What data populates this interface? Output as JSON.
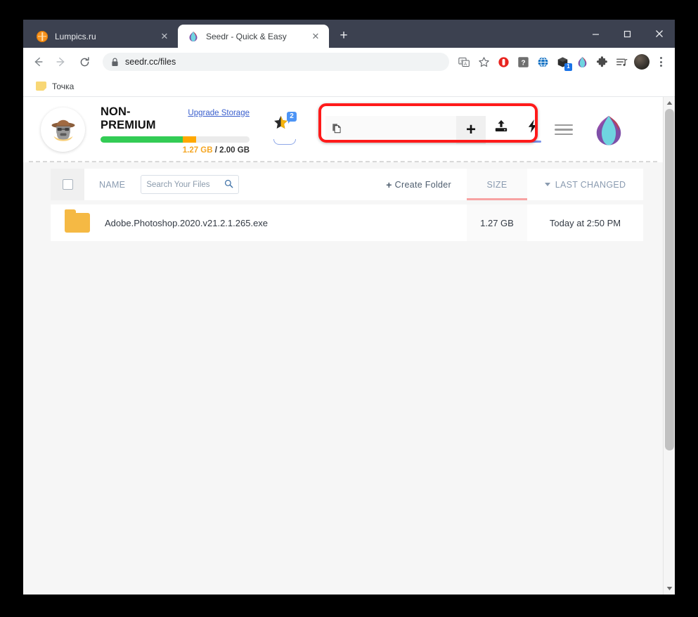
{
  "browser": {
    "tabs": [
      {
        "title": "Lumpics.ru",
        "favicon": "orange-circle-icon",
        "active": false,
        "close_label": "✕"
      },
      {
        "title": "Seedr - Quick & Easy",
        "favicon": "seedr-lotus-icon",
        "active": true,
        "close_label": "✕"
      }
    ],
    "new_tab_label": "+",
    "window_controls": {
      "minimize": "minimize-icon",
      "maximize": "maximize-icon",
      "close": "close-icon"
    },
    "nav": {
      "back": "back-arrow-icon",
      "forward": "forward-arrow-icon",
      "reload": "reload-icon"
    },
    "omnibox": {
      "lock": "lock-icon",
      "url": "seedr.cc/files"
    },
    "toolbar_icons": [
      {
        "name": "translate-icon"
      },
      {
        "name": "bookmark-star-icon"
      },
      {
        "name": "adblock-icon"
      },
      {
        "name": "question-extension-icon"
      },
      {
        "name": "globe-extension-icon"
      },
      {
        "name": "box-extension-icon",
        "badge": "1"
      },
      {
        "name": "seedr-extension-icon"
      },
      {
        "name": "puzzle-extensions-icon"
      },
      {
        "name": "playlist-icon"
      }
    ],
    "profile": "profile-avatar",
    "menu": "chrome-menu-icon",
    "bookmarks": [
      {
        "label": "Точка",
        "icon": "folder-icon"
      }
    ]
  },
  "seedr": {
    "account": {
      "avatar": "user-avatar-icon",
      "plan": "NON-PREMIUM",
      "upgrade_link": "Upgrade Storage",
      "storage_used": "1.27 GB",
      "storage_separator": "/",
      "storage_total": "2.00 GB",
      "bar_green_pct": 55,
      "bar_orange_pct": 9,
      "colors": {
        "green": "#33cc55",
        "orange": "#ffa800",
        "track": "#ebebeb",
        "used_text": "#f5a623",
        "link": "#3a5fcd"
      }
    },
    "star_widget": {
      "icon": "star-icon",
      "badge": "2",
      "badge_color": "#4d94f5"
    },
    "add_toolbar": {
      "paste_icon": "paste-clipboard-icon",
      "magnet_value": "",
      "magnet_placeholder": "",
      "add_label": "+",
      "upload_icon": "upload-icon",
      "remote_icon": "lightning-bolt-icon",
      "highlight_color": "#ff1a1a"
    },
    "menu_icon": "hamburger-menu-icon",
    "logo": "seedr-lotus-logo",
    "table": {
      "select_all": "select-all-checkbox",
      "columns": {
        "name": "NAME",
        "size": "SIZE",
        "last_changed": "LAST CHANGED"
      },
      "search_placeholder": "Search Your Files",
      "search_value": "",
      "search_icon": "search-icon",
      "create_folder_plus": "+",
      "create_folder_label": "Create Folder",
      "sort_active_column": "SIZE",
      "sort_caret": "caret-down-icon",
      "rows": [
        {
          "icon": "folder-icon",
          "name": "Adobe.Photoshop.2020.v21.2.1.265.exe",
          "size": "1.27 GB",
          "last_changed": "Today at 2:50 PM"
        }
      ]
    }
  }
}
